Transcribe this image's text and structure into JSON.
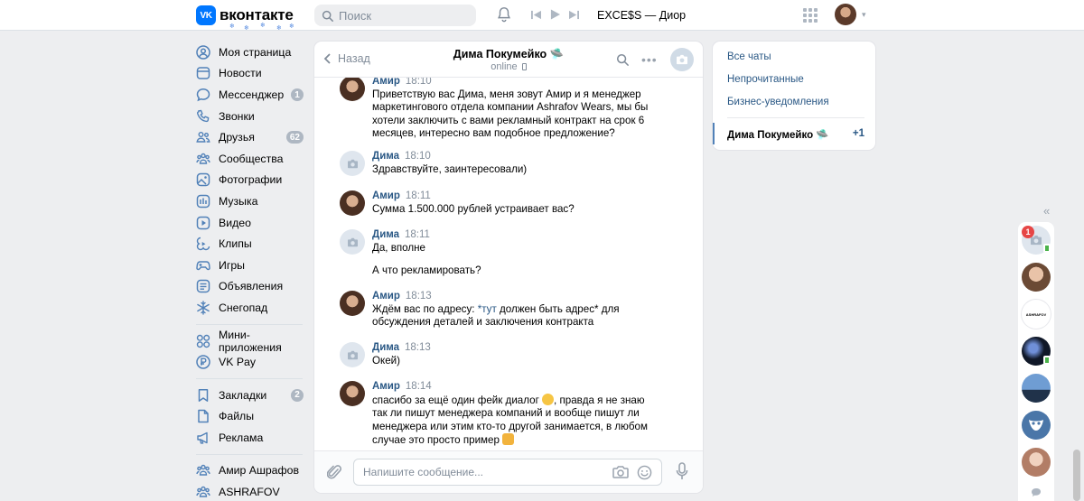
{
  "header": {
    "logo_mark": "VK",
    "logo_text": "вконтакте",
    "search_placeholder": "Поиск",
    "track": "EXCE$S — Диор"
  },
  "sidebar": {
    "items": [
      {
        "label": "Моя страница",
        "icon": "user-icon"
      },
      {
        "label": "Новости",
        "icon": "news-icon"
      },
      {
        "label": "Мессенджер",
        "icon": "chat-icon",
        "badge": "1"
      },
      {
        "label": "Звонки",
        "icon": "phone-icon"
      },
      {
        "label": "Друзья",
        "icon": "friends-icon",
        "badge": "62"
      },
      {
        "label": "Сообщества",
        "icon": "groups-icon"
      },
      {
        "label": "Фотографии",
        "icon": "photo-icon"
      },
      {
        "label": "Музыка",
        "icon": "music-icon"
      },
      {
        "label": "Видео",
        "icon": "video-icon"
      },
      {
        "label": "Клипы",
        "icon": "clips-icon"
      },
      {
        "label": "Игры",
        "icon": "games-icon"
      },
      {
        "label": "Объявления",
        "icon": "ads-icon"
      },
      {
        "label": "Снегопад",
        "icon": "snowflake-icon"
      }
    ],
    "items2": [
      {
        "label": "Мини-приложения",
        "icon": "apps-icon"
      },
      {
        "label": "VK Pay",
        "icon": "pay-icon"
      }
    ],
    "items3": [
      {
        "label": "Закладки",
        "icon": "bookmark-icon",
        "badge": "2"
      },
      {
        "label": "Файлы",
        "icon": "file-icon"
      },
      {
        "label": "Реклама",
        "icon": "megaphone-icon"
      }
    ],
    "items4": [
      {
        "label": "Амир Ашрафов",
        "icon": "groups-icon"
      },
      {
        "label": "ASHRAFOV",
        "icon": "groups-icon"
      }
    ]
  },
  "chat": {
    "back_label": "Назад",
    "peer_name": "Дима Покумейко 🛸",
    "peer_status": "online",
    "messages": [
      {
        "author": "Амир",
        "time": "18:10",
        "text": "Приветствую вас Дима, меня зовут Амир и я менеджер маркетингового отдела компании Ashrafov Wears, мы бы хотели заключить с вами рекламный контракт на срок 6 месяцев, интересно вам подобное предложение?"
      },
      {
        "author": "Дима",
        "time": "18:10",
        "text": "Здравствуйте, заинтересовали)"
      },
      {
        "author": "Амир",
        "time": "18:11",
        "text": "Сумма 1.500.000 рублей устраивает вас?"
      },
      {
        "author": "Дима",
        "time": "18:11",
        "text": "Да, вполне",
        "text2": "А что рекламировать?"
      },
      {
        "author": "Амир",
        "time": "18:13",
        "text_pre": "Ждём вас по адресу: ",
        "link": "*тут",
        "text_post": " должен быть адрес* для обсуждения деталей и заключения контракта"
      },
      {
        "author": "Дима",
        "time": "18:13",
        "text": "Окей)"
      },
      {
        "author": "Амир",
        "time": "18:14",
        "text_a": "спасибо за ещё один фейк диалог ",
        "text_b": ", правда я не знаю так ли пишут менеджера компаний и вообще пишут ли менеджера или этим кто-то другой занимается, в любом случае это просто пример "
      }
    ],
    "composer_placeholder": "Напишите сообщение..."
  },
  "right_panel": {
    "links": [
      "Все чаты",
      "Непрочитанные",
      "Бизнес-уведомления"
    ],
    "active_chat": "Дима Покумейко 🛸",
    "active_count": "+1"
  },
  "bubbles": {
    "badge": "1",
    "label_3": "ASHRAFOV"
  },
  "colors": {
    "accent": "#0077ff",
    "link": "#2a5885",
    "online": "#4bb34b",
    "badge": "#e64646"
  }
}
